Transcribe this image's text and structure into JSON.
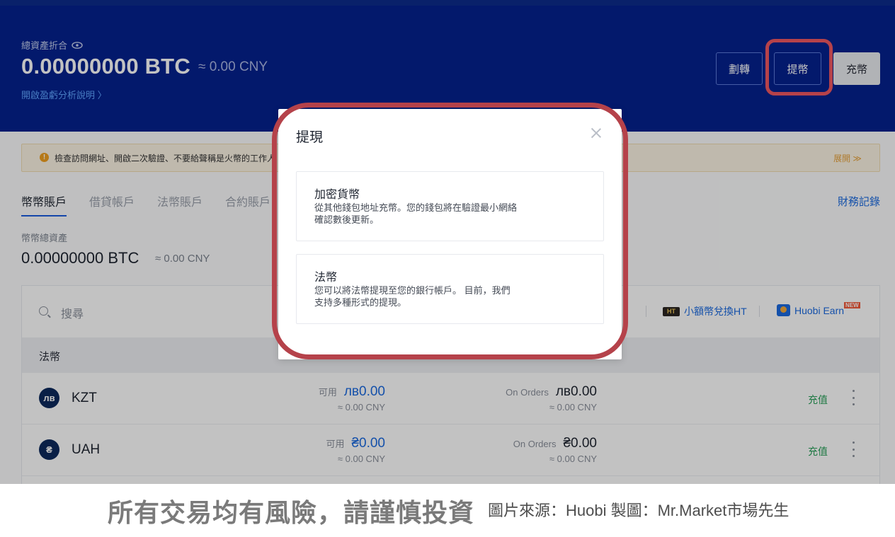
{
  "header": {
    "total_label": "總資產折合",
    "total_btc": "0.00000000 BTC",
    "total_cny": "≈ 0.00 CNY",
    "pnl_link": "開啟盈虧分析說明 〉",
    "buttons": {
      "transfer": "劃轉",
      "withdraw": "提幣",
      "deposit": "充幣"
    },
    "bg_color": "#04218f"
  },
  "notice": {
    "text": "檢查訪問網址、開啟二次驗證、不要給聲稱是火幣的工作人",
    "expand": "展開 ≫"
  },
  "tabs": [
    "幣幣賬戶",
    "借貸帳戶",
    "法幣賬戶",
    "合約賬戶"
  ],
  "records_link": "財務記錄",
  "sub_account": {
    "label": "幣幣總資產",
    "balance": "0.00000000 BTC",
    "approx": "≈ 0.00 CNY"
  },
  "table": {
    "search_placeholder": "搜尋",
    "ht_link": "小額幣兌換HT",
    "ht_icon_text": "HT",
    "earn_link": "Huobi Earn",
    "earn_badge": "NEW",
    "section_title": "法幣",
    "rows": [
      {
        "icon": "лв",
        "name": "KZT",
        "avail_label": "可用",
        "avail_value": "лв0.00",
        "avail_approx": "≈ 0.00 CNY",
        "orders_label": "On Orders",
        "orders_value": "лв0.00",
        "orders_approx": "≈ 0.00 CNY",
        "action": "充值"
      },
      {
        "icon": "₴",
        "name": "UAH",
        "avail_label": "可用",
        "avail_value": "₴0.00",
        "avail_approx": "≈ 0.00 CNY",
        "orders_label": "On Orders",
        "orders_value": "₴0.00",
        "orders_approx": "≈ 0.00 CNY",
        "action": "充值"
      }
    ]
  },
  "modal": {
    "title": "提現",
    "options": [
      {
        "title": "加密貨幣",
        "desc_line1": "從其他錢包地址充幣。您的錢包將在驗證最小網絡",
        "desc_line2": "確認數後更新。"
      },
      {
        "title": "法幣",
        "desc_line1": "您可以將法幣提現至您的銀行帳戶。 目前，我們",
        "desc_line2": "支持多種形式的提現。"
      }
    ]
  },
  "footer": {
    "warning": "所有交易均有風險，請謹慎投資",
    "credit": "圖片來源：Huobi 製圖：Mr.Market市場先生"
  },
  "colors": {
    "highlight": "#b5424a",
    "link_blue": "#1b6ae0",
    "deposit_green": "#2aa05a"
  }
}
